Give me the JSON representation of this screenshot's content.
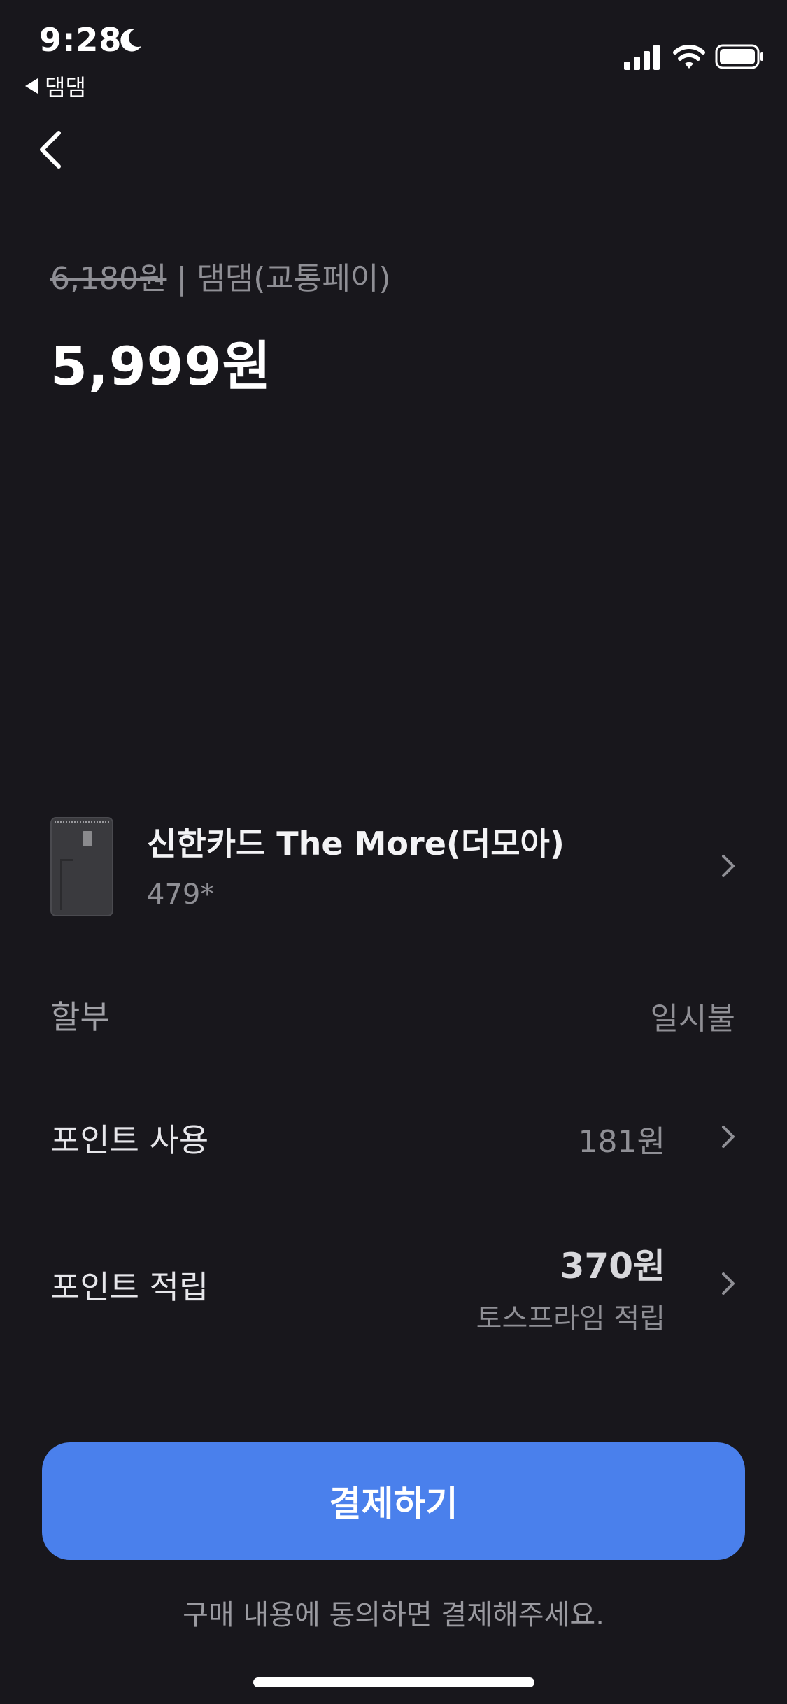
{
  "status_bar": {
    "time": "9:28",
    "back_app_label": "댐댐",
    "icons": [
      "moon-icon",
      "signal-icon",
      "wifi-icon",
      "battery-icon"
    ]
  },
  "nav": {
    "back_icon": "chevron-left-icon"
  },
  "header": {
    "original_price": "6,180원",
    "separator": "|",
    "merchant": "댐댐(교통페이)",
    "final_price": "5,999원"
  },
  "card": {
    "name": "신한카드 The More(더모아)",
    "number": "479*"
  },
  "installment": {
    "label": "할부",
    "value": "일시불"
  },
  "point_use": {
    "label": "포인트 사용",
    "value": "181원"
  },
  "point_earn": {
    "label": "포인트 적립",
    "value": "370원",
    "sub": "토스프라임 적립"
  },
  "pay_button": {
    "label": "결제하기"
  },
  "footer": {
    "note": "구매 내용에 동의하면 결제해주세요."
  },
  "colors": {
    "background": "#18171c",
    "accent": "#4a80ec",
    "text_primary": "#ffffff",
    "text_secondary": "#8f8f95"
  }
}
